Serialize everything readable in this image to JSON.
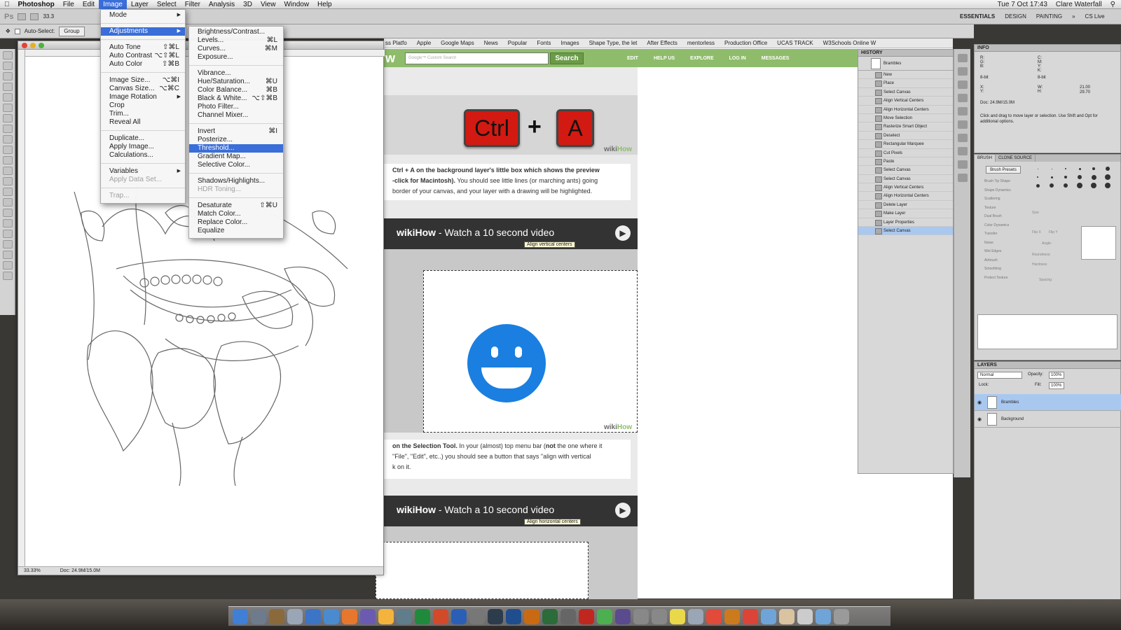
{
  "menubar": {
    "apple": "",
    "app_name": "Photoshop",
    "items": [
      "File",
      "Edit",
      "Image",
      "Layer",
      "Select",
      "Filter",
      "Analysis",
      "3D",
      "View",
      "Window",
      "Help"
    ],
    "active": "Image",
    "clock": "Tue 7 Oct 17:43",
    "user": "Clare Waterfall"
  },
  "toolbar": {
    "ps_label": "Ps",
    "zoom": "33.3",
    "workspaces": [
      "ESSENTIALS",
      "DESIGN",
      "PAINTING"
    ],
    "cs_live": "CS Live"
  },
  "options_bar": {
    "auto_select": "Auto-Select:",
    "group": "Group"
  },
  "image_menu": {
    "items": [
      {
        "label": "Mode",
        "arrow": "▶"
      },
      {
        "sep": true
      },
      {
        "label": "Adjustments",
        "arrow": "▶",
        "highlight": true
      },
      {
        "sep": true
      },
      {
        "label": "Auto Tone",
        "shortcut": "⇧⌘L"
      },
      {
        "label": "Auto Contrast",
        "shortcut": "⌥⇧⌘L"
      },
      {
        "label": "Auto Color",
        "shortcut": "⇧⌘B"
      },
      {
        "sep": true
      },
      {
        "label": "Image Size...",
        "shortcut": "⌥⌘I"
      },
      {
        "label": "Canvas Size...",
        "shortcut": "⌥⌘C"
      },
      {
        "label": "Image Rotation",
        "arrow": "▶"
      },
      {
        "label": "Crop"
      },
      {
        "label": "Trim..."
      },
      {
        "label": "Reveal All"
      },
      {
        "sep": true
      },
      {
        "label": "Duplicate..."
      },
      {
        "label": "Apply Image..."
      },
      {
        "label": "Calculations..."
      },
      {
        "sep": true
      },
      {
        "label": "Variables",
        "arrow": "▶"
      },
      {
        "label": "Apply Data Set...",
        "disabled": true
      },
      {
        "sep": true
      },
      {
        "label": "Trap...",
        "disabled": true
      }
    ]
  },
  "adjustments_menu": {
    "items": [
      {
        "label": "Brightness/Contrast..."
      },
      {
        "label": "Levels...",
        "shortcut": "⌘L"
      },
      {
        "label": "Curves...",
        "shortcut": "⌘M"
      },
      {
        "label": "Exposure..."
      },
      {
        "sep": true
      },
      {
        "label": "Vibrance..."
      },
      {
        "label": "Hue/Saturation...",
        "shortcut": "⌘U"
      },
      {
        "label": "Color Balance...",
        "shortcut": "⌘B"
      },
      {
        "label": "Black & White...",
        "shortcut": "⌥⇧⌘B"
      },
      {
        "label": "Photo Filter..."
      },
      {
        "label": "Channel Mixer..."
      },
      {
        "sep": true
      },
      {
        "label": "Invert",
        "shortcut": "⌘I"
      },
      {
        "label": "Posterize..."
      },
      {
        "label": "Threshold...",
        "highlight": true
      },
      {
        "label": "Gradient Map..."
      },
      {
        "label": "Selective Color..."
      },
      {
        "sep": true
      },
      {
        "label": "Shadows/Highlights..."
      },
      {
        "label": "HDR Toning...",
        "disabled": true
      },
      {
        "sep": true
      },
      {
        "label": "Desaturate",
        "shortcut": "⇧⌘U"
      },
      {
        "label": "Match Color..."
      },
      {
        "label": "Replace Color..."
      },
      {
        "label": "Equalize"
      }
    ]
  },
  "document": {
    "zoom": "33.33%",
    "doc_size": "Doc: 24.9M/15.0M"
  },
  "browser": {
    "bookmarks": [
      "ss Platfo",
      "Apple",
      "Google Maps",
      "News",
      "Popular",
      "Fonts",
      "Images",
      "Shape Type, the let",
      "After Effects",
      "mentorless",
      "Production Office",
      "UCAS TRACK",
      "W3Schools Online W"
    ],
    "search_placeholder": "Google™ Custom Search",
    "search_button": "Search",
    "nav": [
      "EDIT",
      "HELP US",
      "EXPLORE",
      "LOG IN",
      "MESSAGES"
    ],
    "logo_fragment": "w"
  },
  "article": {
    "ctrl_key": "Ctrl",
    "a_key": "A",
    "plus": "+",
    "watermark_a": "wiki",
    "watermark_b": "How",
    "step1_bold": "Ctrl + A on the background layer's little box which shows the preview",
    "step1_bold2": "-click for Macintosh).",
    "step1_rest": " You should see little lines (or marching ants) going",
    "step1_line3": "border of your canvas, and your layer with a drawing will be highlighted.",
    "video_brand": "wikiHow",
    "video_title": " - Watch a 10 second video",
    "tip1": "Align vertical centers",
    "tip2": "Align horizontal centers",
    "step2_bold": "on the Selection Tool.",
    "step2_rest": " In your (almost) top menu bar (",
    "step2_not": "not",
    "step2_rest2": " the one where it",
    "step2_line2": "\"File\", \"Edit\", etc..) you should see a button that says \"align with vertical",
    "step2_line3": "k on it."
  },
  "history": {
    "title": "HISTORY",
    "snapshot": "Brambles",
    "items": [
      "New",
      "Place",
      "Select Canvas",
      "Align Vertical Centers",
      "Align Horizontal Centers",
      "Move Selection",
      "Rasterize Smart Object",
      "Deselect",
      "Rectangular Marquee",
      "Cut Pixels",
      "Paste",
      "Select Canvas",
      "Select Canvas",
      "Align Vertical Centers",
      "Align Horizontal Centers",
      "Delete Layer",
      "Make Layer",
      "Layer Properties",
      "Select Canvas"
    ],
    "selected_index": 18
  },
  "info": {
    "title": "INFO",
    "doc": "Doc: 24.9M/15.0M",
    "hint": "Click and drag to move layer or selection.  Use Shift and Opt for additional options.",
    "w": "21.00",
    "h": "29.70",
    "bit1": "8-bit",
    "bit2": "8-bit"
  },
  "brush": {
    "tabs": [
      "BRUSH",
      "CLONE SOURCE"
    ],
    "presets_button": "Brush Presets",
    "options": [
      "Brush Tip Shape",
      "Shape Dynamics",
      "Scattering",
      "Texture",
      "Dual Brush",
      "Color Dynamics",
      "Transfer",
      "Noise",
      "Wet Edges",
      "Airbrush",
      "Smoothing",
      "Protect Texture"
    ],
    "tip_sizes": [
      "1",
      "3",
      "5",
      "9",
      "13",
      "19",
      "5",
      "9",
      "13",
      "17",
      "21",
      "27",
      "16",
      "18",
      "18",
      "24",
      "28",
      "36"
    ],
    "size_label": "Size",
    "angle_label": "Angle:",
    "roundness_label": "Roundness:",
    "hardness_label": "Hardness",
    "spacing_label": "Spacing",
    "flipx": "Flip X",
    "flipy": "Flip Y"
  },
  "layers": {
    "title": "LAYERS",
    "blend": "Normal",
    "opacity_label": "Opacity:",
    "opacity": "100%",
    "lock_label": "Lock:",
    "fill_label": "Fill:",
    "fill": "100%",
    "items": [
      {
        "name": "Brambles",
        "selected": true
      },
      {
        "name": "Background",
        "selected": false
      }
    ]
  },
  "dock": {
    "apps": [
      "Finder",
      "Preview",
      "Automator",
      "Launchpad",
      "Mail",
      "iTunes",
      "Firefox",
      "iMovie",
      "Pages",
      "Preview",
      "Excel",
      "PowerPoint",
      "Word",
      "Keychain",
      "Lightroom",
      "Photoshop",
      "Illustrator",
      "Dreamweaver",
      "Aperture",
      "Acrobat",
      "Numbers",
      "After Effects",
      "?",
      "?",
      "Stickies",
      "Preview",
      "Calendar",
      "iBooks",
      "Chrome",
      "Folder",
      "Home",
      "Document",
      "Folder",
      "Trash"
    ]
  },
  "colors": {
    "menu_highlight": "#3a6ed8",
    "wikihow_green": "#8fbc6b",
    "key_red": "#d21a12",
    "smiley_blue": "#1a7fe0",
    "selection_blue": "#a9c8f0"
  }
}
